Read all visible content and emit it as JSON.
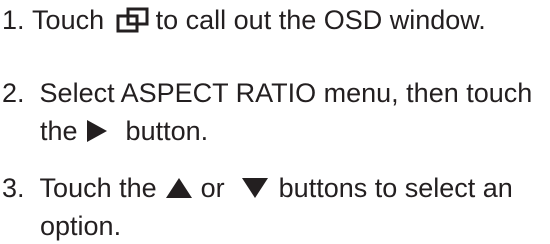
{
  "steps": [
    {
      "number": "1.",
      "line1_before": "Touch",
      "line1_icon": "menu-squares-icon",
      "line1_after": "to call out the OSD window."
    },
    {
      "number": "2.",
      "line1": "Select ASPECT RATIO menu, then touch",
      "line2_before": "the",
      "line2_icon": "triangle-right-icon",
      "line2_after": "button."
    },
    {
      "number": "3.",
      "line1_before": "Touch the",
      "line1_icon_a": "triangle-up-icon",
      "line1_middle": "or",
      "line1_icon_b": "triangle-down-icon",
      "line1_after": "buttons to select an",
      "line2": "option."
    }
  ],
  "colors": {
    "text": "#231f20"
  }
}
